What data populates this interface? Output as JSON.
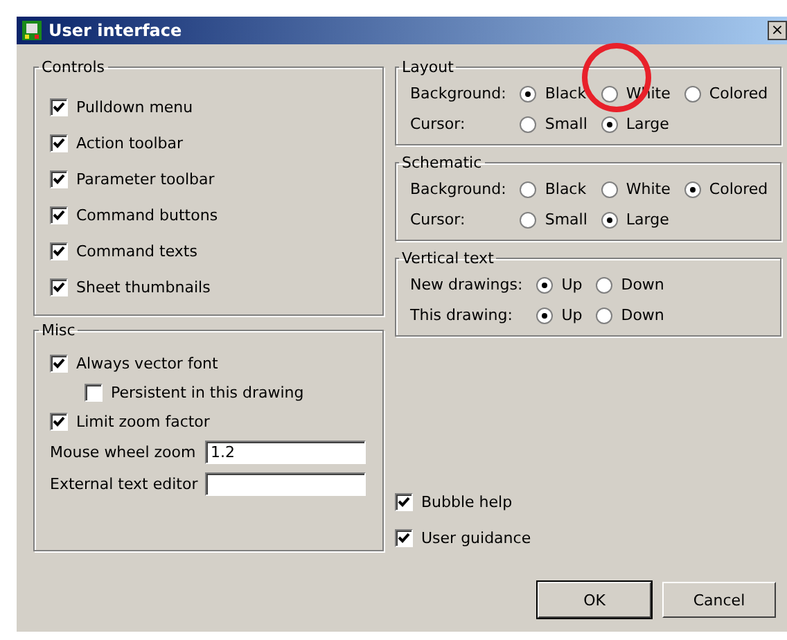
{
  "window": {
    "title": "User interface",
    "close": "×"
  },
  "left_groups": [
    {
      "title": "Controls",
      "items": [
        {
          "kind": "checkbox",
          "label": "Pulldown menu",
          "checked": true
        },
        {
          "kind": "checkbox",
          "label": "Action toolbar",
          "checked": true
        },
        {
          "kind": "checkbox",
          "label": "Parameter toolbar",
          "checked": true
        },
        {
          "kind": "checkbox",
          "label": "Command buttons",
          "checked": true
        },
        {
          "kind": "checkbox",
          "label": "Command texts",
          "checked": true
        },
        {
          "kind": "checkbox",
          "label": "Sheet thumbnails",
          "checked": true
        }
      ]
    },
    {
      "title": "Misc",
      "items": [
        {
          "kind": "checkbox",
          "label": "Always vector font",
          "checked": true,
          "children": [
            {
              "kind": "checkbox",
              "label": "Persistent in this drawing",
              "checked": false
            }
          ]
        },
        {
          "kind": "checkbox",
          "label": "Limit zoom factor",
          "checked": true
        },
        {
          "kind": "field",
          "label": "Mouse wheel zoom",
          "value": "1.2"
        },
        {
          "kind": "field",
          "label": "External text editor"
        }
      ]
    }
  ],
  "right_groups": [
    {
      "title": "Layout",
      "rows": [
        {
          "label": "Background:",
          "options": [
            {
              "label": "Black",
              "selected": true
            },
            {
              "label": "White",
              "selected": false,
              "circled": true
            },
            {
              "label": "Colored",
              "selected": false
            }
          ]
        },
        {
          "label": "Cursor:",
          "options": [
            {
              "label": "Small",
              "selected": false
            },
            {
              "label": "Large",
              "selected": true
            }
          ]
        }
      ]
    },
    {
      "title": "Schematic",
      "rows": [
        {
          "label": "Background:",
          "options": [
            {
              "label": "Black",
              "selected": false
            },
            {
              "label": "White",
              "selected": false
            },
            {
              "label": "Colored",
              "selected": true
            }
          ]
        },
        {
          "label": "Cursor:",
          "options": [
            {
              "label": "Small",
              "selected": false
            },
            {
              "label": "Large",
              "selected": true
            }
          ]
        }
      ]
    },
    {
      "title": "Vertical text",
      "rows": [
        {
          "label": "New drawings:",
          "options": [
            {
              "label": "Up",
              "selected": true
            },
            {
              "label": "Down",
              "selected": false
            }
          ]
        },
        {
          "label": "This drawing:",
          "options": [
            {
              "label": "Up",
              "selected": true
            },
            {
              "label": "Down",
              "selected": false
            }
          ]
        }
      ]
    }
  ],
  "options": [
    {
      "label": "Bubble help",
      "checked": true
    },
    {
      "label": "User guidance",
      "checked": true
    }
  ],
  "buttons": [
    "OK",
    "Cancel"
  ]
}
